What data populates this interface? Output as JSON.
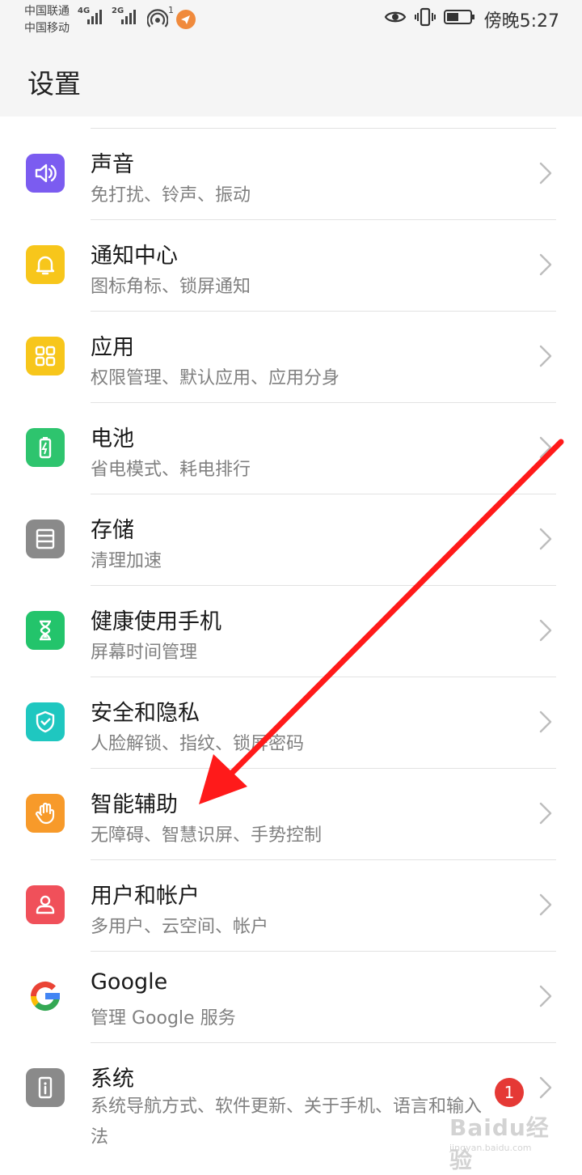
{
  "status_bar": {
    "carrier1": "中国联通",
    "carrier2": "中国移动",
    "net1": "4G",
    "net2": "2G",
    "hotspot_count": "1",
    "time": "傍晚5:27"
  },
  "header": {
    "title": "设置"
  },
  "settings": [
    {
      "name": "声音",
      "desc": "免打扰、铃声、振动",
      "icon": "speaker-icon",
      "color": "#7b5cf0"
    },
    {
      "name": "通知中心",
      "desc": "图标角标、锁屏通知",
      "icon": "bell-icon",
      "color": "#f7c61b"
    },
    {
      "name": "应用",
      "desc": "权限管理、默认应用、应用分身",
      "icon": "apps-grid-icon",
      "color": "#f7c61b"
    },
    {
      "name": "电池",
      "desc": "省电模式、耗电排行",
      "icon": "battery-icon",
      "color": "#2ec46e"
    },
    {
      "name": "存储",
      "desc": "清理加速",
      "icon": "storage-icon",
      "color": "#8a8a8a"
    },
    {
      "name": "健康使用手机",
      "desc": "屏幕时间管理",
      "icon": "hourglass-icon",
      "color": "#23c46b"
    },
    {
      "name": "安全和隐私",
      "desc": "人脸解锁、指纹、锁屏密码",
      "icon": "shield-icon",
      "color": "#1fc7c0"
    },
    {
      "name": "智能辅助",
      "desc": "无障碍、智慧识屏、手势控制",
      "icon": "hand-icon",
      "color": "#f79a2a"
    },
    {
      "name": "用户和帐户",
      "desc": "多用户、云空间、帐户",
      "icon": "user-icon",
      "color": "#f0505a"
    },
    {
      "name": "Google",
      "desc": "管理 Google 服务",
      "icon": "google-icon",
      "color": "#ffffff"
    },
    {
      "name": "系统",
      "desc": "系统导航方式、软件更新、关于手机、语言和输入法",
      "icon": "phone-info-icon",
      "color": "#8a8a8a",
      "badge": "1"
    }
  ],
  "watermark": {
    "logo": "Baidu经验",
    "url": "jingyan.baidu.com"
  },
  "colors": {
    "annotation_arrow": "#ff1a1a",
    "badge": "#e53935"
  }
}
